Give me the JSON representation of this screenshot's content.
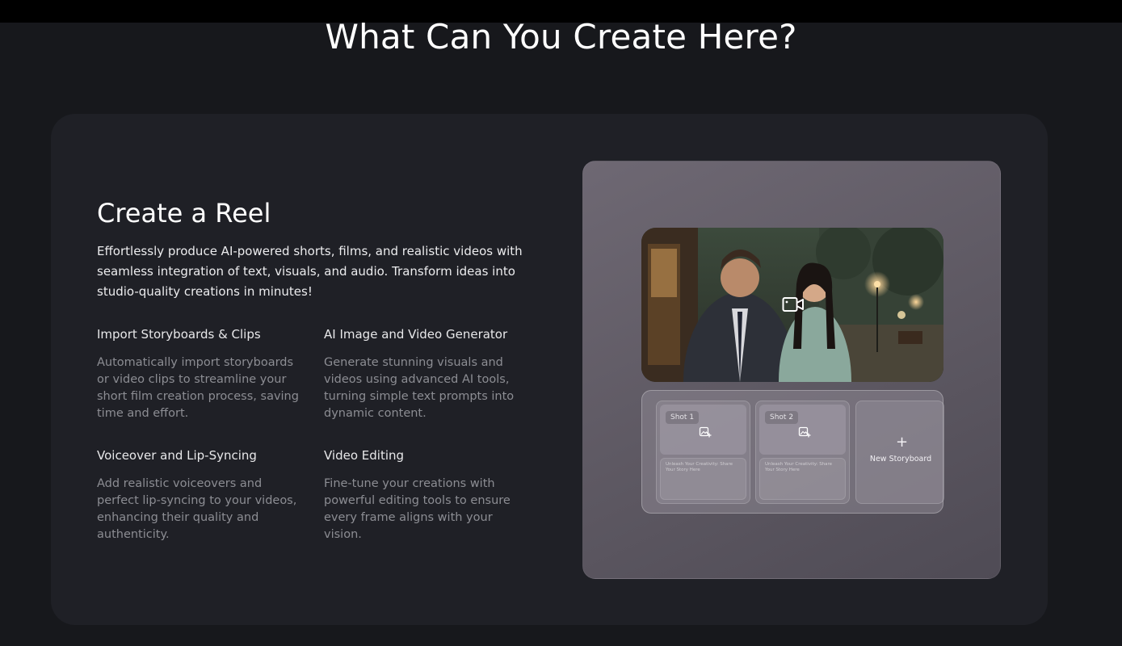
{
  "header": {
    "title": "What Can You Create Here?"
  },
  "section": {
    "title": "Create a Reel",
    "description": "Effortlessly produce AI-powered shorts, films, and realistic videos with seamless integration of text, visuals, and audio. Transform ideas into studio-quality creations in minutes!",
    "features": [
      {
        "title": "Import Storyboards & Clips",
        "text": "Automatically import storyboards or video clips to streamline your short film creation process, saving time and effort."
      },
      {
        "title": "AI Image and Video Generator",
        "text": "Generate stunning visuals and videos using advanced AI tools, turning simple text prompts into dynamic content."
      },
      {
        "title": "Voiceover and Lip-Syncing",
        "text": "Add realistic voiceovers and perfect lip-syncing to your videos, enhancing their quality and authenticity."
      },
      {
        "title": "Video Editing",
        "text": "Fine-tune your creations with powerful editing tools to ensure every frame aligns with your vision."
      }
    ]
  },
  "preview": {
    "video_icon": "video-camera-icon",
    "shots": [
      {
        "label": "Shot 1",
        "prompt": "Unleash Your Creativity: Share Your Story Here"
      },
      {
        "label": "Shot 2",
        "prompt": "Unleash Your Creativity: Share Your Story Here"
      }
    ],
    "new_storyboard_label": "New Storyboard",
    "plus": "+"
  },
  "colors": {
    "background": "#17181c",
    "card": "#1f2026",
    "panel": "#625d67",
    "muted_text": "#8c8d93"
  }
}
